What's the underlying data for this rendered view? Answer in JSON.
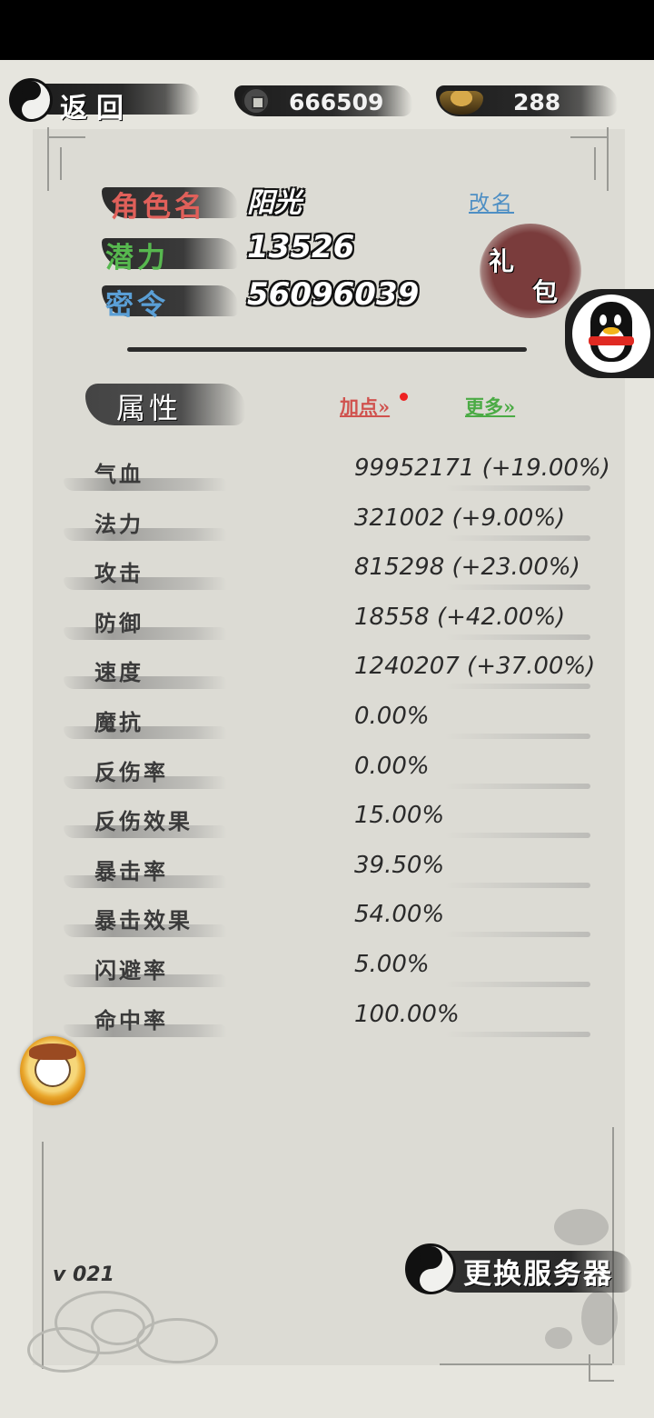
{
  "topbar": {
    "back_label": "返回",
    "coins": "666509",
    "ingots": "288"
  },
  "profile": {
    "name_label": "角色名",
    "name_value": "阳光",
    "potential_label": "潜力",
    "potential_value": "13526",
    "password_label": "密令",
    "password_value": "56096039",
    "rename_label": "改名",
    "gift_chars": [
      "礼",
      "包"
    ],
    "colors": {
      "name_label": "#d9534f",
      "potential_label": "#4cae4c",
      "password_label": "#4a90c8"
    }
  },
  "attributes": {
    "tab_label": "属性",
    "add_points_label": "加点»",
    "more_label": "更多»",
    "rows": [
      {
        "name": "气血",
        "value": "99952171 (+19.00%)"
      },
      {
        "name": "法力",
        "value": "321002 (+9.00%)"
      },
      {
        "name": "攻击",
        "value": "815298 (+23.00%)"
      },
      {
        "name": "防御",
        "value": "18558 (+42.00%)"
      },
      {
        "name": "速度",
        "value": "1240207 (+37.00%)"
      },
      {
        "name": "魔抗",
        "value": "0.00%"
      },
      {
        "name": "反伤率",
        "value": "0.00%"
      },
      {
        "name": "反伤效果",
        "value": "15.00%"
      },
      {
        "name": "暴击率",
        "value": "39.50%"
      },
      {
        "name": "暴击效果",
        "value": "54.00%"
      },
      {
        "name": "闪避率",
        "value": "5.00%"
      },
      {
        "name": "命中率",
        "value": "100.00%"
      }
    ]
  },
  "footer": {
    "version": "v 021",
    "switch_server_label": "更换服务器"
  },
  "icons": {
    "back": "taiji-icon",
    "coin": "copper-coin-icon",
    "ingot": "gold-ingot-icon",
    "qq": "qq-penguin-icon",
    "avatar": "rabbit-avatar-icon",
    "switch": "taiji-icon"
  }
}
